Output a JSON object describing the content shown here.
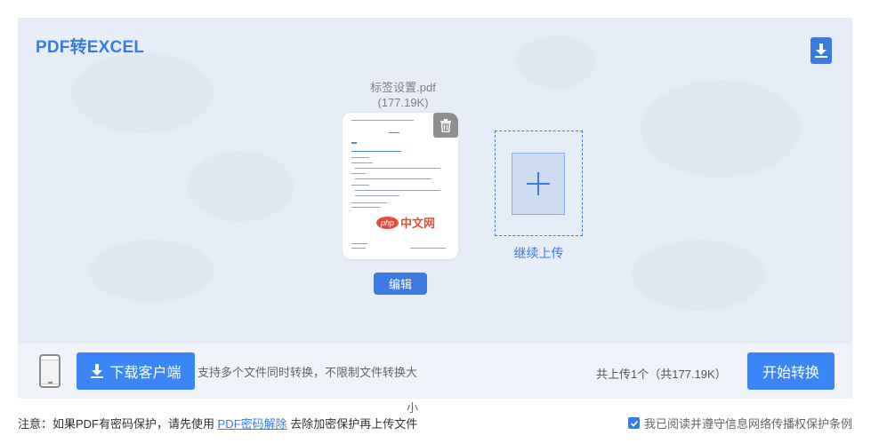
{
  "header": {
    "title": "PDF转EXCEL"
  },
  "file": {
    "name": "标签设置.pdf",
    "size": "(177.19K)",
    "watermark_php": "php",
    "watermark_text": "中文网"
  },
  "actions": {
    "edit_label": "编辑",
    "add_more_label": "继续上传"
  },
  "bottom_bar": {
    "download_client_label": "下载客户端",
    "support_text": "支持多个文件同时转换，不限制文件转换大",
    "support_text_wrap": "小",
    "upload_count": "共上传1个（共177.19K）",
    "start_label": "开始转换"
  },
  "footer": {
    "notice_prefix": "注意：如果PDF有密码保护，请先使用",
    "notice_link": "PDF密码解除",
    "notice_suffix": "去除加密保护再上传文件",
    "agree_text": "我已阅读并遵守信息网络传播权保护条例"
  },
  "colors": {
    "accent": "#3a7be0",
    "button": "#3a86f7",
    "panel": "#e7edf6"
  }
}
